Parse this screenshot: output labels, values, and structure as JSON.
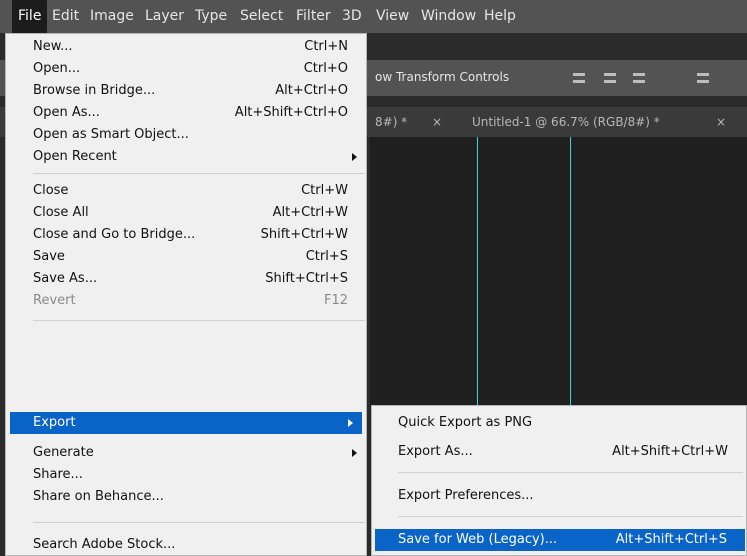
{
  "menubar": {
    "items": [
      "File",
      "Edit",
      "Image",
      "Layer",
      "Type",
      "Select",
      "Filter",
      "3D",
      "View",
      "Window",
      "Help"
    ]
  },
  "options_bar": {
    "label": "ow Transform Controls"
  },
  "tabs": {
    "tab1": "8#) *",
    "tab1_close": "×",
    "tab2": "Untitled-1 @ 66.7% (RGB/8#) *",
    "tab2_close": "×"
  },
  "file_menu": {
    "items": [
      {
        "label": "New...",
        "shortcut": "Ctrl+N"
      },
      {
        "label": "Open...",
        "shortcut": "Ctrl+O"
      },
      {
        "label": "Browse in Bridge...",
        "shortcut": "Alt+Ctrl+O"
      },
      {
        "label": "Open As...",
        "shortcut": "Alt+Shift+Ctrl+O"
      },
      {
        "label": "Open as Smart Object...",
        "shortcut": ""
      },
      {
        "label": "Open Recent",
        "shortcut": ""
      },
      {
        "label": "Close",
        "shortcut": "Ctrl+W"
      },
      {
        "label": "Close All",
        "shortcut": "Alt+Ctrl+W"
      },
      {
        "label": "Close and Go to Bridge...",
        "shortcut": "Shift+Ctrl+W"
      },
      {
        "label": "Save",
        "shortcut": "Ctrl+S"
      },
      {
        "label": "Save As...",
        "shortcut": "Shift+Ctrl+S"
      },
      {
        "label": "Revert",
        "shortcut": "F12"
      },
      {
        "label": "Export",
        "shortcut": ""
      },
      {
        "label": "Generate",
        "shortcut": ""
      },
      {
        "label": "Share...",
        "shortcut": ""
      },
      {
        "label": "Share on Behance...",
        "shortcut": ""
      },
      {
        "label": "Search Adobe Stock...",
        "shortcut": ""
      }
    ]
  },
  "export_submenu": {
    "items": [
      {
        "label": "Quick Export as PNG",
        "shortcut": ""
      },
      {
        "label": "Export As...",
        "shortcut": "Alt+Shift+Ctrl+W"
      },
      {
        "label": "Export Preferences...",
        "shortcut": ""
      },
      {
        "label": "Save for Web (Legacy)...",
        "shortcut": "Alt+Shift+Ctrl+S"
      }
    ]
  }
}
